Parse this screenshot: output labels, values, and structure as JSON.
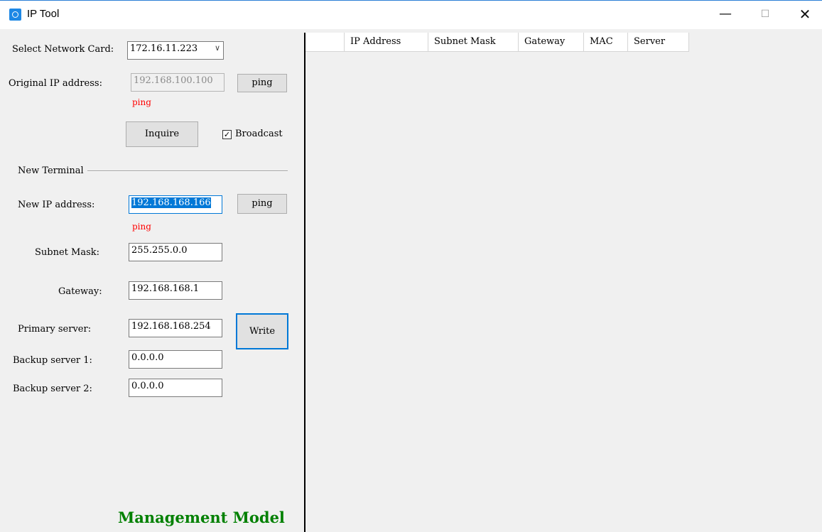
{
  "window": {
    "title": "IP Tool"
  },
  "left": {
    "network_card_label": "Select Network Card:",
    "network_card_value": "172.16.11.223",
    "original_ip_label": "Original IP address:",
    "original_ip_value": "192.168.100.100",
    "ping_label": "ping",
    "ping_status_1": "ping",
    "inquire_label": "Inquire",
    "broadcast_label": "Broadcast",
    "broadcast_checked": "✓",
    "new_terminal_label": "New Terminal",
    "new_ip_label": "New IP address:",
    "new_ip_value": "192.168.168.166",
    "ping_status_2": "ping",
    "subnet_label": "Subnet Mask:",
    "subnet_value": "255.255.0.0",
    "gateway_label": "Gateway:",
    "gateway_value": "192.168.168.1",
    "primary_label": "Primary server:",
    "primary_value": "192.168.168.254",
    "write_label": "Write",
    "backup1_label": "Backup server 1:",
    "backup1_value": "0.0.0.0",
    "backup2_label": "Backup server 2:",
    "backup2_value": "0.0.0.0",
    "mode_label": "Management Model"
  },
  "table": {
    "columns": [
      "",
      "IP Address",
      "Subnet Mask",
      "Gateway",
      "MAC",
      "Server"
    ]
  },
  "colors": {
    "accent": "#0078d7",
    "status_red": "#ff0000",
    "mode_green": "#008000"
  }
}
